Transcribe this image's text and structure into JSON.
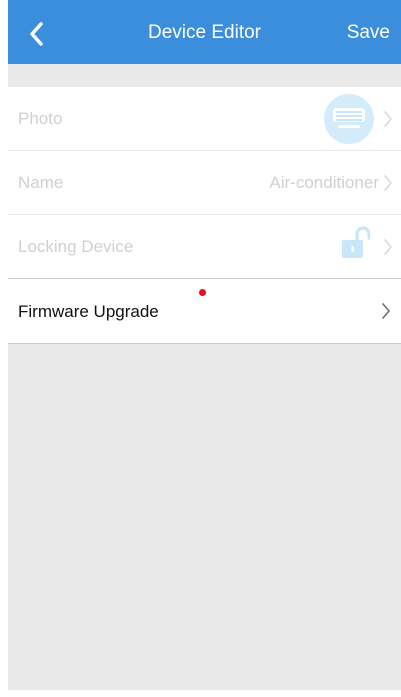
{
  "header": {
    "title": "Device Editor",
    "save_label": "Save"
  },
  "rows": {
    "photo": {
      "label": "Photo"
    },
    "name": {
      "label": "Name",
      "value": "Air-conditioner"
    },
    "locking": {
      "label": "Locking Device"
    },
    "firmware": {
      "label": "Firmware Upgrade"
    }
  },
  "colors": {
    "navbar": "#3b8edb",
    "background": "#e9e9e9",
    "disabled_text": "#d0d0d0",
    "badge": "#e30d24",
    "icon_accent": "#c8e6fa"
  }
}
